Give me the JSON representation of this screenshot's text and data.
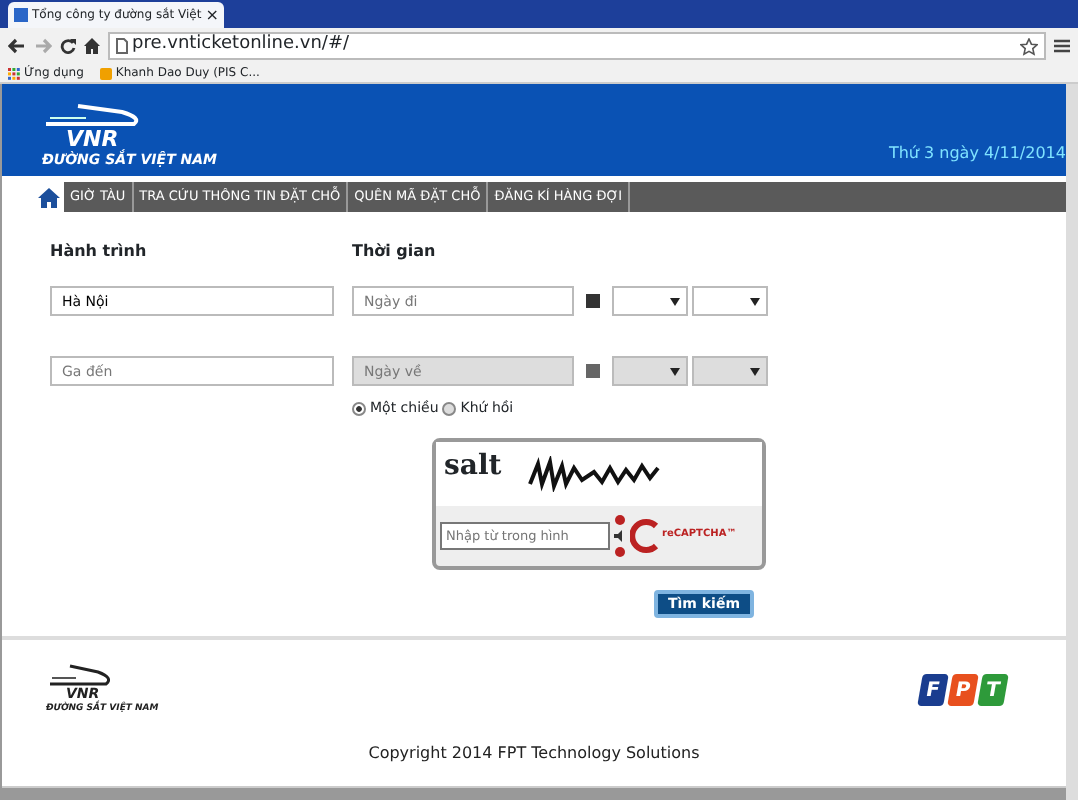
{
  "browser": {
    "tab_title": "Tổng công ty đường sắt Việt",
    "tab_close": "×",
    "address": "pre.vnticketonline.vn/#/",
    "bookmarks": [
      "Ứng dụng",
      "Khanh Dao Duy (PIS C..."
    ]
  },
  "header": {
    "logo_text": "VNR",
    "logo_subtitle": "ĐƯỜNG SẮT VIỆT NAM",
    "date": "Thứ 3 ngày 4/11/2014"
  },
  "nav": {
    "items": [
      "GIỜ TÀU",
      "TRA CỨU THÔNG TIN ĐẶT CHỖ",
      "QUÊN MÃ ĐẶT CHỖ",
      "ĐĂNG KÍ HÀNG ĐỢI"
    ]
  },
  "form": {
    "route_heading": "Hành trình",
    "time_heading": "Thời gian",
    "stations": [
      {
        "value": "Hà Nội"
      },
      {
        "placeholder": "Ga đến"
      }
    ],
    "dates": [
      {
        "placeholder": "Ngày đi",
        "disabled": false
      },
      {
        "placeholder": "Ngày về",
        "disabled": true
      }
    ],
    "trip_types": [
      {
        "label": "Một chiều",
        "selected": true
      },
      {
        "label": "Khứ hồi",
        "selected": false
      }
    ],
    "captcha": {
      "word": "salt",
      "placeholder": "Nhập từ trong hình",
      "brand": "reCAPTCHA™"
    },
    "search_button": "Tìm kiếm"
  },
  "footer": {
    "logo_text": "VNR",
    "logo_subtitle": "ĐƯỜNG SẮT VIỆT NAM",
    "partner_letters": [
      {
        "letter": "F",
        "color": "#1a3d8f"
      },
      {
        "letter": "P",
        "color": "#e8501e"
      },
      {
        "letter": "T",
        "color": "#2e9a3a"
      }
    ],
    "copyright": "Copyright 2014 FPT Technology Solutions"
  }
}
